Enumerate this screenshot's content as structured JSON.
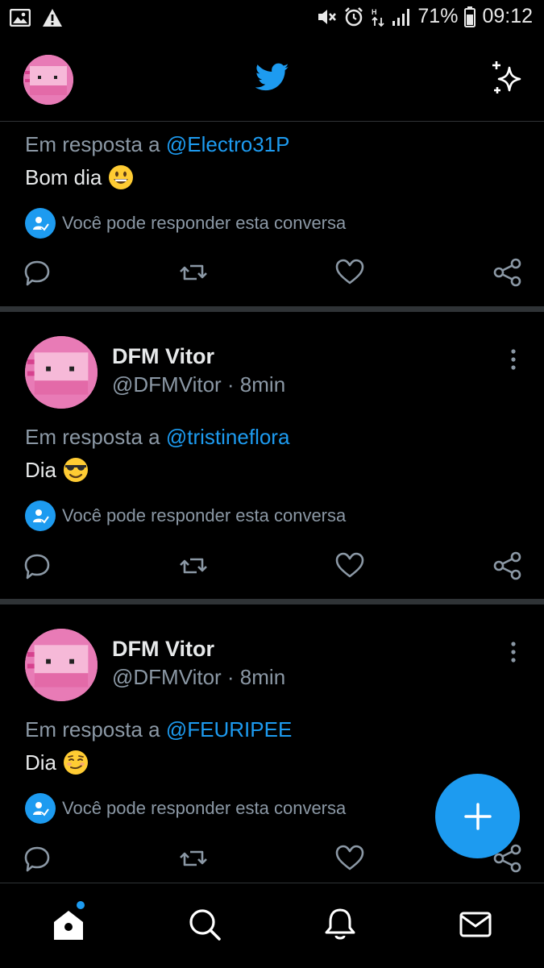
{
  "status_bar": {
    "battery": "71%",
    "time": "09:12"
  },
  "header": {
    "logo_icon": "twitter-bird-icon",
    "sparkle_icon": "sparkle-icon"
  },
  "colors": {
    "accent": "#1d9bf0",
    "background": "#000000",
    "secondary_text": "#8b98a5",
    "divider": "#2f3336"
  },
  "tweets": [
    {
      "replying_prefix": "Em resposta a",
      "replying_to": "@Electro31P",
      "text": "Bom dia",
      "emoji": "grinning-face",
      "can_reply": "Você pode responder esta conversa"
    },
    {
      "name": "DFM Vitor",
      "handle": "@DFMVitor · 8min",
      "replying_prefix": "Em resposta a",
      "replying_to": "@tristineflora",
      "text": "Dia",
      "emoji": "smiling-face-with-sunglasses",
      "can_reply": "Você pode responder esta conversa"
    },
    {
      "name": "DFM Vitor",
      "handle": "@DFMVitor · 8min",
      "replying_prefix": "Em resposta a",
      "replying_to": "@FEURIPEE",
      "text": "Dia",
      "emoji": "smirking-face",
      "can_reply": "Você pode responder esta conversa"
    }
  ],
  "bottom_nav": [
    "home-icon",
    "search-icon",
    "notifications-icon",
    "messages-icon"
  ]
}
